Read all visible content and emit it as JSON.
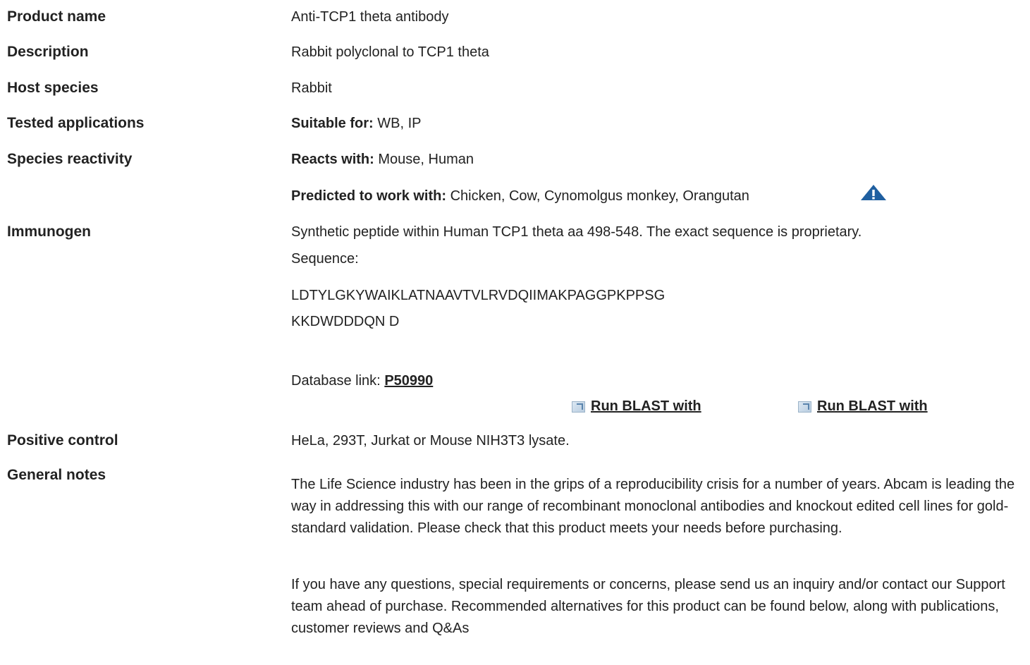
{
  "rows": {
    "product_name": {
      "label": "Product name",
      "value": "Anti-TCP1 theta antibody"
    },
    "description": {
      "label": "Description",
      "value": "Rabbit polyclonal to TCP1 theta"
    },
    "host_species": {
      "label": "Host species",
      "value": "Rabbit"
    },
    "tested_applications": {
      "label": "Tested applications",
      "prefix": "Suitable for:",
      "value": "WB, IP"
    },
    "species_reactivity": {
      "label": "Species reactivity",
      "reacts_prefix": "Reacts with:",
      "reacts_value": "Mouse, Human",
      "predicted_prefix": "Predicted to work with:",
      "predicted_value": "Chicken, Cow, Cynomolgus monkey, Orangutan"
    },
    "immunogen": {
      "label": "Immunogen",
      "line1": "Synthetic peptide within Human TCP1 theta aa 498-548. The exact sequence is proprietary.",
      "line2": "Sequence:",
      "seq1": "LDTYLGKYWAIKLATNAAVTVLRVDQIIMAKPAGGPKPPSG",
      "seq2": "KKDWDDDQN D",
      "db_prefix": "Database link:",
      "db_link": "P50990",
      "blast1": "Run BLAST with",
      "blast2": "Run BLAST with"
    },
    "positive_control": {
      "label": "Positive control",
      "value": "HeLa, 293T, Jurkat or Mouse NIH3T3 lysate."
    },
    "general_notes": {
      "label": "General notes",
      "para1": "The Life Science industry has been in the grips of a reproducibility crisis for a number of years. Abcam is leading the way in addressing this with our range of recombinant monoclonal antibodies and knockout edited cell lines for gold-standard validation. Please check that this product meets your needs before purchasing.",
      "para2": "If you have any questions, special requirements or concerns, please send us an inquiry and/or contact our Support team ahead of purchase. Recommended alternatives for this product can be found below, along with publications, customer reviews and Q&As"
    }
  },
  "icons": {
    "warning": "warning-triangle-icon",
    "external": "external-link-icon"
  },
  "colors": {
    "warning_blue": "#1f5fa0",
    "text": "#222222"
  }
}
